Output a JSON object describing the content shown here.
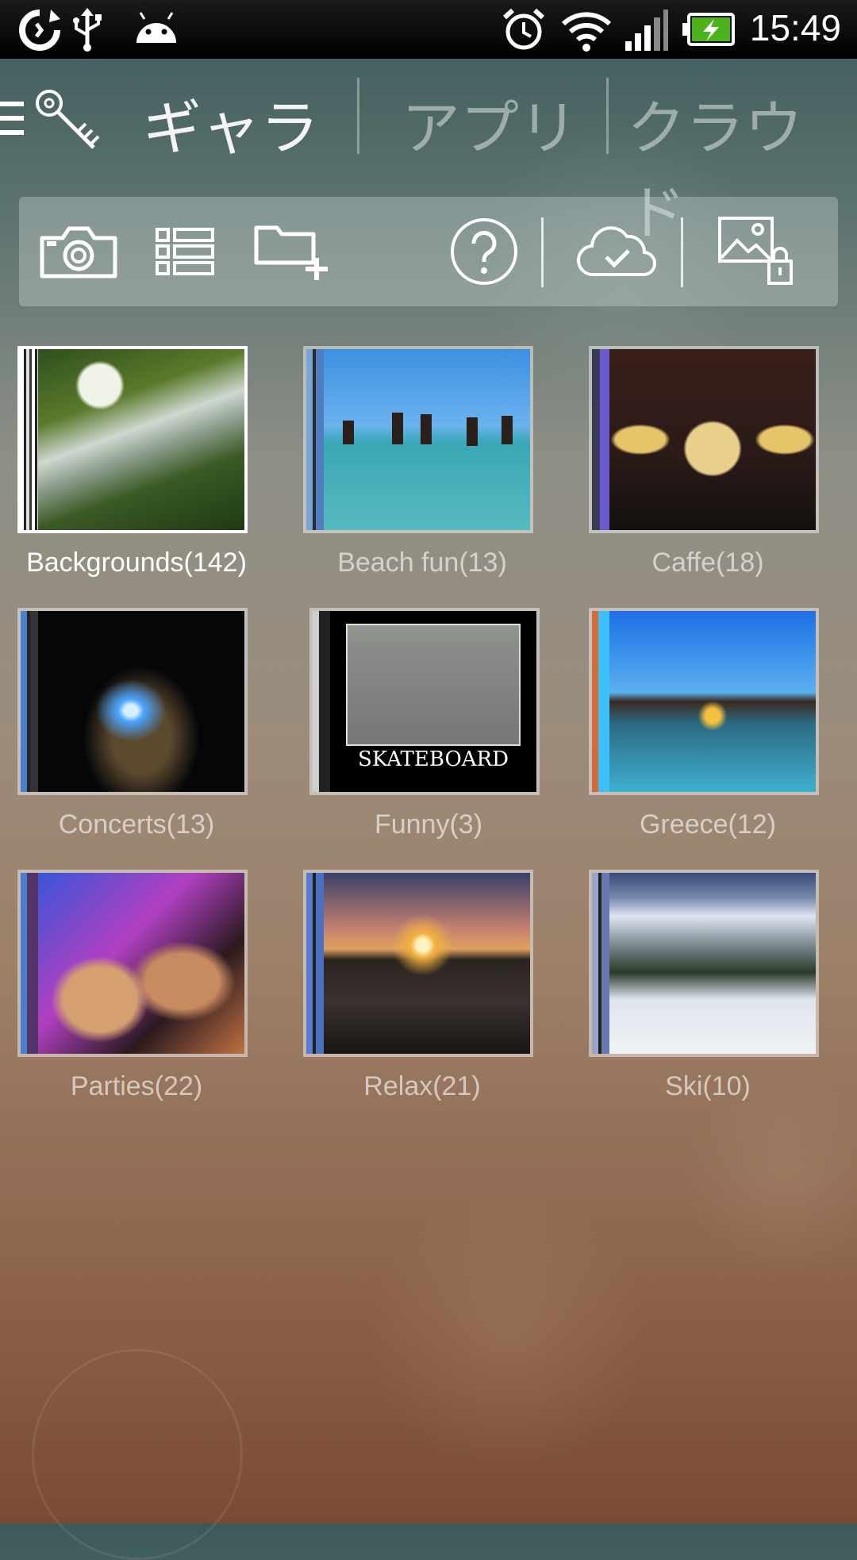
{
  "status_bar": {
    "time": "15:49",
    "left_icons": [
      "sync-icon",
      "usb-icon",
      "android-icon"
    ],
    "right_icons": [
      "alarm-icon",
      "wifi-icon",
      "signal-icon",
      "battery-charging-icon"
    ]
  },
  "tabs": [
    {
      "label": "ギャラ",
      "active": true
    },
    {
      "label": "アプリ",
      "active": false
    },
    {
      "label": "クラウド",
      "active": false
    }
  ],
  "toolbar": {
    "buttons": [
      "camera-icon",
      "list-view-icon",
      "add-folder-icon",
      "help-icon",
      "cloud-sync-icon",
      "locked-image-icon"
    ]
  },
  "albums": [
    {
      "label": "Backgrounds(142)",
      "selected": true
    },
    {
      "label": "Beach fun(13)",
      "selected": false
    },
    {
      "label": "Caffe(18)",
      "selected": false
    },
    {
      "label": "Concerts(13)",
      "selected": false
    },
    {
      "label": "Funny(3)",
      "selected": false
    },
    {
      "label": "Greece(12)",
      "selected": false
    },
    {
      "label": "Parties(22)",
      "selected": false
    },
    {
      "label": "Relax(21)",
      "selected": false
    },
    {
      "label": "Ski(10)",
      "selected": false
    }
  ],
  "funny_caption": "SKATEBOARD",
  "colors": {
    "header_bg": "#3c5a5a",
    "bottom_bg": "#7a4a36",
    "selected_label": "#ffffff",
    "inactive_label": "#c8c0b8"
  }
}
